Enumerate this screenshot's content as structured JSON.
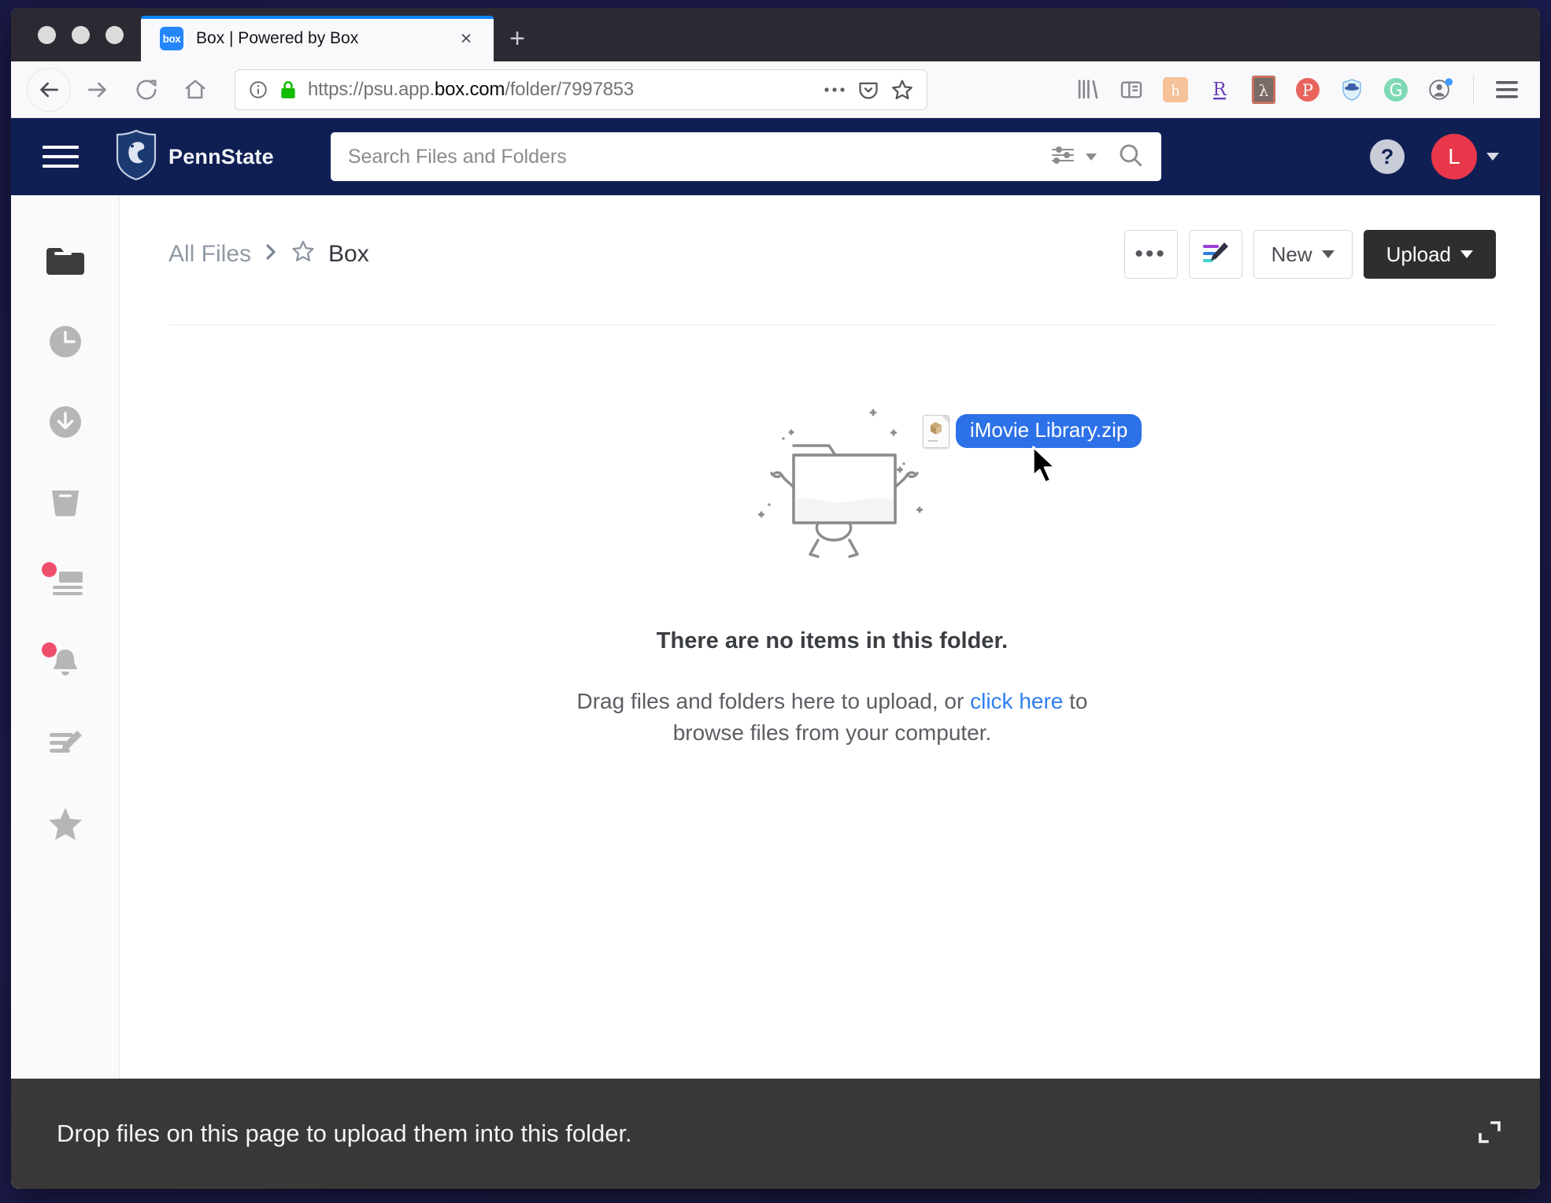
{
  "browser": {
    "tab": {
      "title": "Box | Powered by Box",
      "favicon_text": "box",
      "close_label": "×"
    },
    "new_tab_label": "+",
    "url": {
      "scheme": "https://",
      "host_dim_left": "psu.app.",
      "host_bold": "box.com",
      "path_dim": "/folder/7997853"
    },
    "url_full": "https://psu.app.box.com/folder/7997853",
    "nav": {
      "back": "back-arrow",
      "forward": "forward-arrow",
      "reload": "reload",
      "home": "home"
    },
    "url_actions": {
      "info": "page-info",
      "lock": "secure-lock",
      "more": "…",
      "pocket": "pocket",
      "bookmark": "star"
    },
    "extensions": [
      "library-icon",
      "reader-sidebar-icon",
      "hypothesis-icon",
      "researcher-r-icon",
      "adobe-acrobat-icon",
      "pinterest-icon",
      "ghostery-icon",
      "grammarly-icon",
      "account-icon"
    ],
    "menu": "app-menu"
  },
  "box": {
    "brand": {
      "name": "PennState",
      "logo": "penn-state-shield"
    },
    "search": {
      "placeholder": "Search Files and Folders",
      "value": ""
    },
    "help_label": "?",
    "avatar": {
      "initial": "L",
      "color": "#e8374a"
    },
    "rail": [
      {
        "name": "all-files",
        "icon": "folder-icon",
        "active": true,
        "badge": false
      },
      {
        "name": "recents",
        "icon": "clock-icon",
        "active": false,
        "badge": false
      },
      {
        "name": "synced",
        "icon": "download-circle-icon",
        "active": false,
        "badge": false
      },
      {
        "name": "trash",
        "icon": "trash-icon",
        "active": false,
        "badge": false
      },
      {
        "name": "updates",
        "icon": "feed-icon",
        "active": false,
        "badge": true
      },
      {
        "name": "notifications",
        "icon": "bell-icon",
        "active": false,
        "badge": true
      },
      {
        "name": "notes",
        "icon": "notes-pencil-icon",
        "active": false,
        "badge": false
      },
      {
        "name": "favorites",
        "icon": "star-icon",
        "active": false,
        "badge": false
      }
    ],
    "breadcrumb": {
      "root": "All Files",
      "separator": "›",
      "current": "Box",
      "favorite_icon": "star-outline-icon"
    },
    "toolbar": {
      "more_label": "•••",
      "notes_label": "box-note-icon",
      "new_label": "New",
      "upload_label": "Upload"
    },
    "empty_state": {
      "illustration": "empty-folder-character",
      "title": "There are no items in this folder.",
      "text_before": "Drag files and folders here to upload, or ",
      "link": "click here",
      "text_after": " to browse files from your computer."
    },
    "drop_bar": {
      "text": "Drop files on this page to upload them into this folder.",
      "expand_icon": "expand-icon"
    }
  },
  "drag": {
    "file_name": "iMovie Library.zip",
    "file_icon": "zip-archive-icon",
    "highlight_color": "#2d71e8",
    "cursor": "arrow-cursor"
  }
}
